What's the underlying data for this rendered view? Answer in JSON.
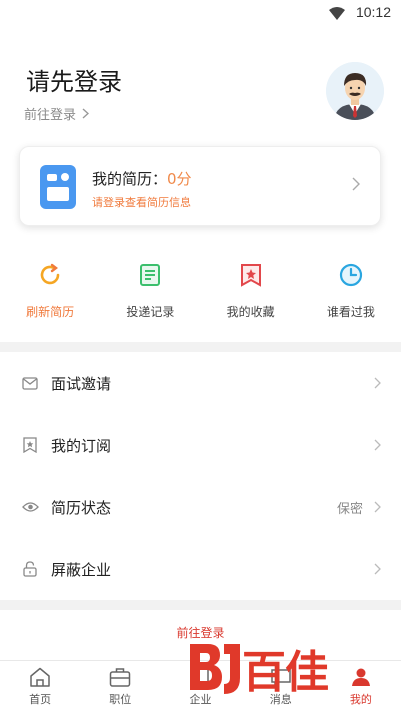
{
  "status_bar": {
    "time": "10:12"
  },
  "header": {
    "title": "请先登录",
    "subtitle": "前往登录"
  },
  "resume_card": {
    "title": "我的简历：",
    "score": "0分",
    "subtitle": "请登录查看简历信息"
  },
  "quick_actions": [
    {
      "label": "刷新简历",
      "icon": "refresh-icon",
      "color": "#f5a623"
    },
    {
      "label": "投递记录",
      "icon": "document-icon",
      "color": "#3cbf6d"
    },
    {
      "label": "我的收藏",
      "icon": "favorite-icon",
      "color": "#e2474b"
    },
    {
      "label": "谁看过我",
      "icon": "clock-icon",
      "color": "#2aa6e0"
    }
  ],
  "menu": [
    {
      "label": "面试邀请",
      "icon": "mail-icon",
      "value": ""
    },
    {
      "label": "我的订阅",
      "icon": "bookmark-icon",
      "value": ""
    },
    {
      "label": "简历状态",
      "icon": "eye-icon",
      "value": "保密"
    },
    {
      "label": "屏蔽企业",
      "icon": "lock-icon",
      "value": ""
    }
  ],
  "goto_login": "前往登录",
  "tabs": [
    {
      "label": "首页",
      "icon": "home-icon"
    },
    {
      "label": "职位",
      "icon": "briefcase-icon"
    },
    {
      "label": "企业",
      "icon": "building-icon"
    },
    {
      "label": "消息",
      "icon": "message-icon"
    },
    {
      "label": "我的",
      "icon": "person-icon"
    }
  ],
  "watermark": "百佳",
  "colors": {
    "accent": "#f07a3c",
    "brand_red": "#d9382e",
    "resume_blue": "#4a98f0"
  }
}
